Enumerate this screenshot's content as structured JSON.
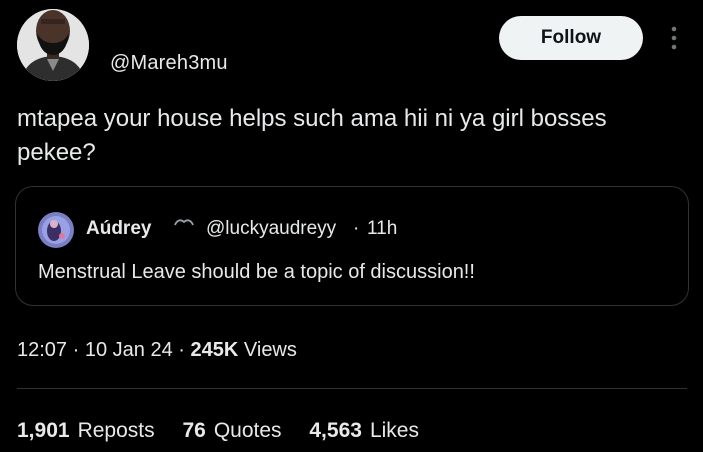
{
  "author": {
    "handle": "@Mareh3mu",
    "avatar": "profile-photo-avatar"
  },
  "actions": {
    "follow_label": "Follow",
    "more_icon": "more-vertical-icon"
  },
  "tweet": {
    "text": "mtapea your house helps such ama hii ni ya girl bosses pekee?"
  },
  "quote": {
    "name": "Aúdrey",
    "heart_icon": "black-heart-emoji",
    "handle": "@luckyaudreyy",
    "separator": "·",
    "time": "11h",
    "text": "Menstrual Leave should be a topic of discussion!!"
  },
  "meta": {
    "time": "12:07",
    "sep1": "·",
    "date": "10 Jan 24",
    "sep2": "·",
    "views_count": "245K",
    "views_label": "Views"
  },
  "stats": [
    {
      "count": "1,901",
      "label": "Reposts"
    },
    {
      "count": "76",
      "label": "Quotes"
    },
    {
      "count": "4,563",
      "label": "Likes"
    }
  ],
  "colors": {
    "background": "#000000",
    "text": "#e7e9ea",
    "border": "#2f3336",
    "follow_bg": "#eff3f4",
    "follow_text": "#0f1419"
  }
}
